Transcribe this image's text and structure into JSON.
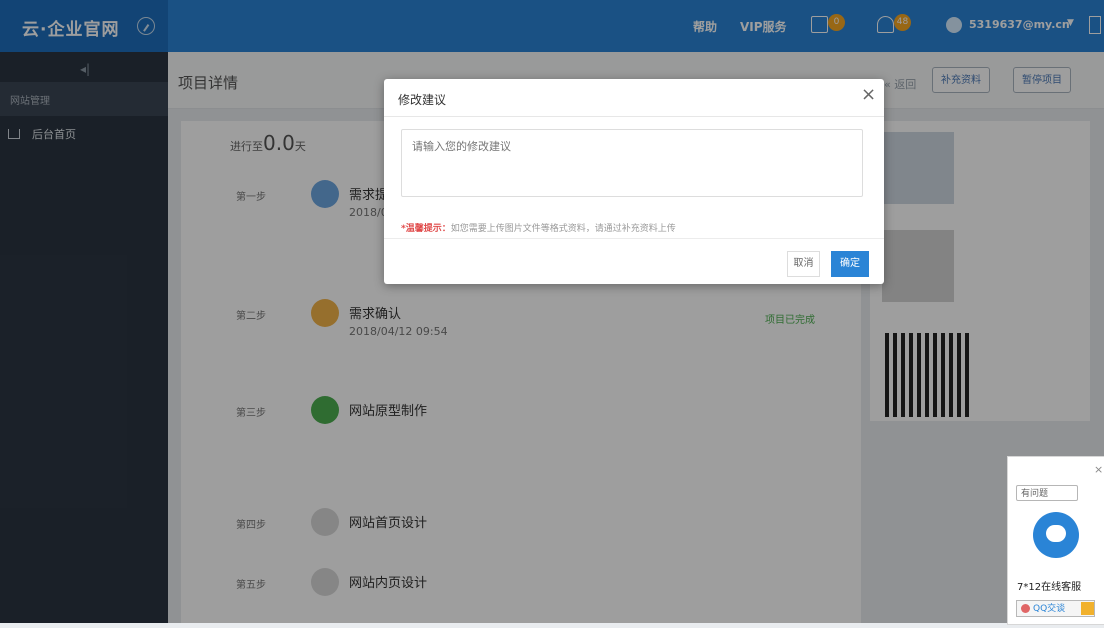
{
  "topbar": {
    "brand": "云·企业官网",
    "help": "帮助",
    "vip": "VIP服务",
    "badge_1": "0",
    "badge_2": "48",
    "user": "5319637@my.cn"
  },
  "sidebar": {
    "group": "网站管理",
    "home": "后台首页"
  },
  "header": {
    "title": "项目详情",
    "back": "« 返回",
    "btn_1": "补充资料",
    "btn_2": "暂停项目"
  },
  "timeline": {
    "days_label": "进行至",
    "days_value": "0.0",
    "days_unit": "天",
    "steps": [
      {
        "label": "第一步",
        "title": "需求提",
        "time": "2018/0"
      },
      {
        "label": "第二步",
        "title": "需求确认",
        "time": "2018/04/12 09:54"
      },
      {
        "label": "第三步",
        "title": "网站原型制作"
      },
      {
        "label": "第四步",
        "title": "网站首页设计"
      },
      {
        "label": "第五步",
        "title": "网站内页设计"
      }
    ],
    "step2_status": "项目已完成"
  },
  "modal": {
    "title": "修改建议",
    "close": "×",
    "placeholder": "请输入您的修改建议",
    "tip_label": "*温馨提示：",
    "tip_text": "如您需要上传图片文件等格式资料，请通过补充资料上传",
    "cancel": "取消",
    "ok": "确定"
  },
  "chat": {
    "question": "有问题",
    "text": "7*12在线客服",
    "qq": "QQ交谈"
  },
  "colors": {
    "primary": "#2a84d6",
    "sidebar": "#2b3542",
    "accent": "#f6a623"
  }
}
